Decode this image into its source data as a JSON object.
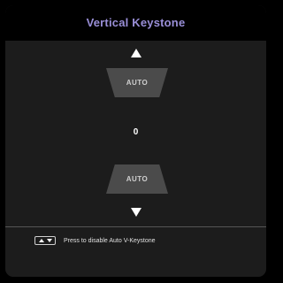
{
  "dialog": {
    "title": "Vertical Keystone"
  },
  "keystone": {
    "top_shape_label": "AUTO",
    "value": "0",
    "bottom_shape_label": "AUTO"
  },
  "footer": {
    "hint_text": "Press to disable Auto V-Keystone",
    "hint_icon": "up-down-key-icon"
  },
  "colors": {
    "title": "#9a8fd8",
    "panel_bg": "#1c1c1c",
    "title_bar_bg": "#000000",
    "shape_fill": "#4b4b4b"
  }
}
